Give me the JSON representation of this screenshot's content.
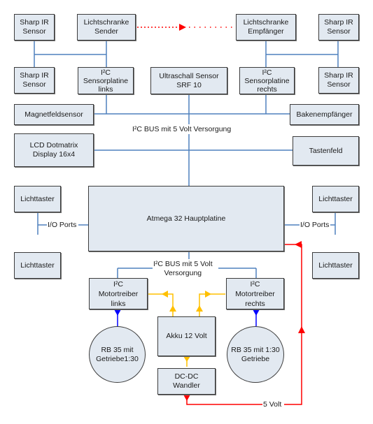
{
  "colors": {
    "box_fill": "#e2e9f1",
    "box_border": "#3c3c3c",
    "bus_line": "#4f81bd",
    "motor_line": "#0000ff",
    "power_12v": "#ffc000",
    "power_5v": "#ff0000",
    "ir_link": "#ff0000"
  },
  "nodes": {
    "sharp_ir_tl": "Sharp IR\nSensor",
    "lichtschranke_sender": "Lichtschranke\nSender",
    "lichtschranke_empfaenger": "Lichtschranke\nEmpfänger",
    "sharp_ir_tr": "Sharp IR\nSensor",
    "sharp_ir_bl": "Sharp IR\nSensor",
    "sensorplatine_links": "I²C\nSensorplatine\nlinks",
    "ultraschall": "Ultraschall Sensor\nSRF 10",
    "sensorplatine_rechts": "I²C\nSensorplatine\nrechts",
    "sharp_ir_br": "Sharp IR\nSensor",
    "magnetfeldsensor": "Magnetfeldsensor",
    "bakenempfaenger": "Bakenempfänger",
    "lcd": "LCD Dotmatrix\nDisplay 16x4",
    "tastenfeld": "Tastenfeld",
    "lichttaster_lt": "Lichttaster",
    "lichttaster_lb": "Lichttaster",
    "atmega": "Atmega 32 Hauptplatine",
    "lichttaster_rt": "Lichttaster",
    "lichttaster_rb": "Lichttaster",
    "motortreiber_links": "I²C\nMotortreiber\nlinks",
    "motortreiber_rechts": "I²C\nMotortreiber\nrechts",
    "akku": "Akku 12 Volt",
    "motor_links": "RB 35 mit\nGetriebe1:30",
    "motor_rechts": "RB 35 mit 1:30\nGetriebe",
    "dcdc": "DC-DC\nWandler"
  },
  "labels": {
    "i2c_bus_top": "I²C BUS mit 5 Volt Versorgung",
    "i2c_bus_bottom": "I²C BUS mit  5 Volt\nVersorgung",
    "io_ports_left": "I/O Ports",
    "io_ports_right": "I/O Ports",
    "five_volt": "5 Volt"
  }
}
